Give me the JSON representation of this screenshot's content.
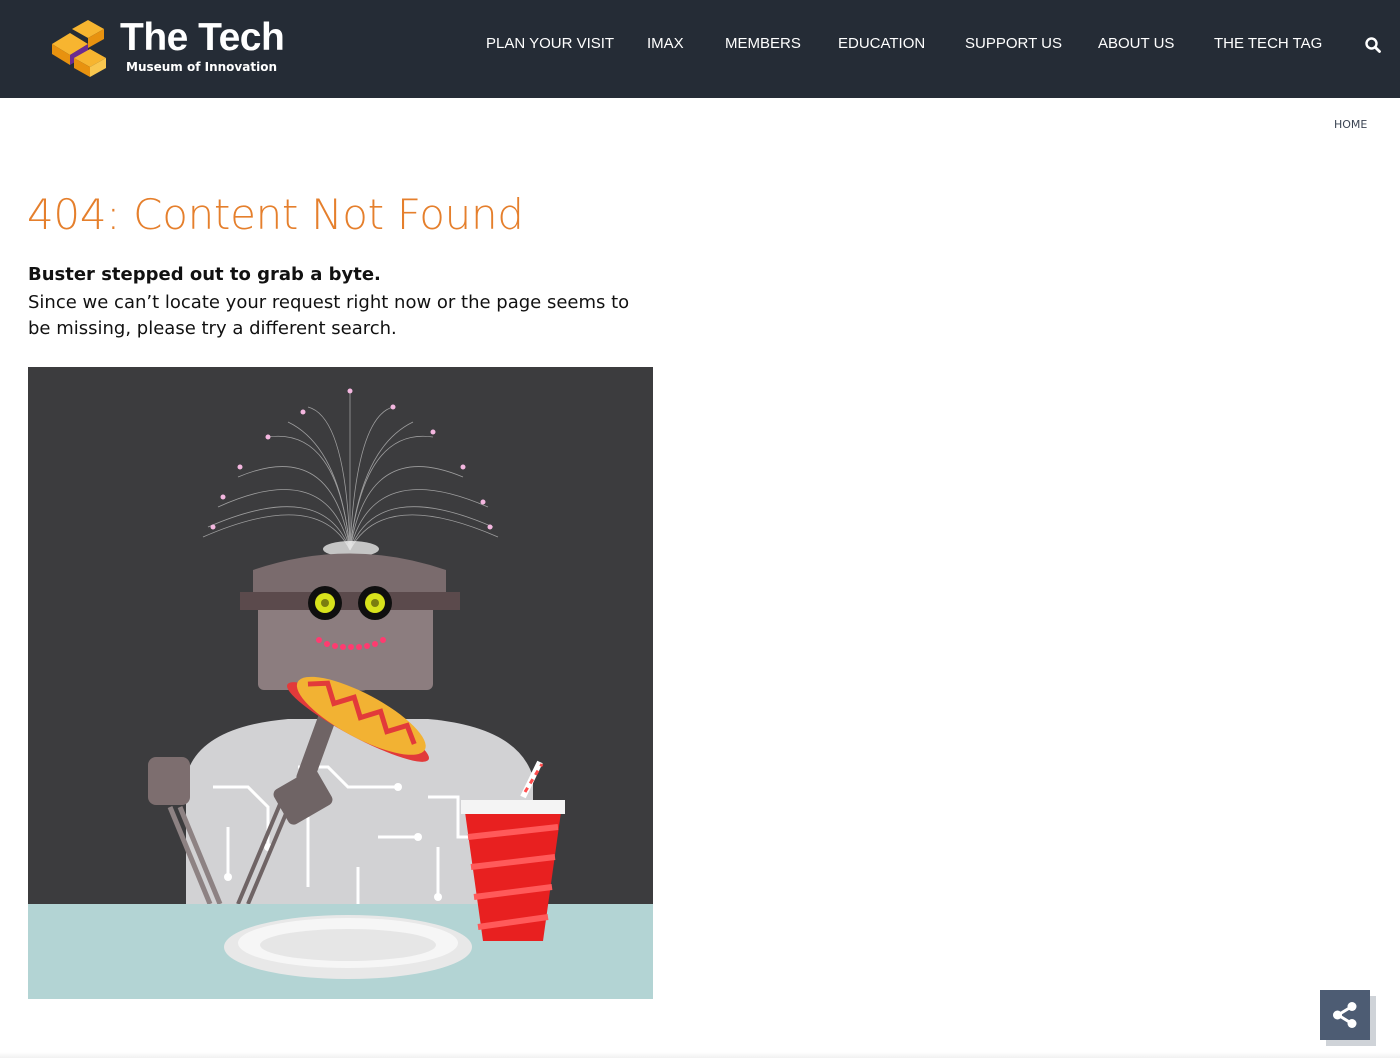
{
  "header": {
    "logo": {
      "title": "The Tech",
      "subtitle": "Museum of Innovation"
    },
    "nav": [
      {
        "label": "PLAN YOUR VISIT",
        "name": "nav-plan-your-visit"
      },
      {
        "label": "IMAX",
        "name": "nav-imax"
      },
      {
        "label": "MEMBERS",
        "name": "nav-members"
      },
      {
        "label": "EDUCATION",
        "name": "nav-education"
      },
      {
        "label": "SUPPORT US",
        "name": "nav-support-us"
      },
      {
        "label": "ABOUT US",
        "name": "nav-about-us"
      },
      {
        "label": "THE TECH TAG",
        "name": "nav-the-tech-tag"
      }
    ],
    "search_icon": "search-icon"
  },
  "breadcrumb": {
    "home": "HOME"
  },
  "content": {
    "title": "404: Content Not Found",
    "lead": "Buster stepped out to grab a byte.",
    "body": "Since we can’t locate your request right now or the page seems to be missing, please try a different search."
  },
  "illustration": {
    "subject": "robot-eating-hotdog-illustration"
  },
  "share": {
    "icon": "share-icon"
  },
  "colors": {
    "header_bg": "#252c36",
    "title_accent": "#e57f2c",
    "share_bg": "#4d5c73",
    "scene_bg": "#3c3c3e",
    "table": "#b3d4d4"
  }
}
